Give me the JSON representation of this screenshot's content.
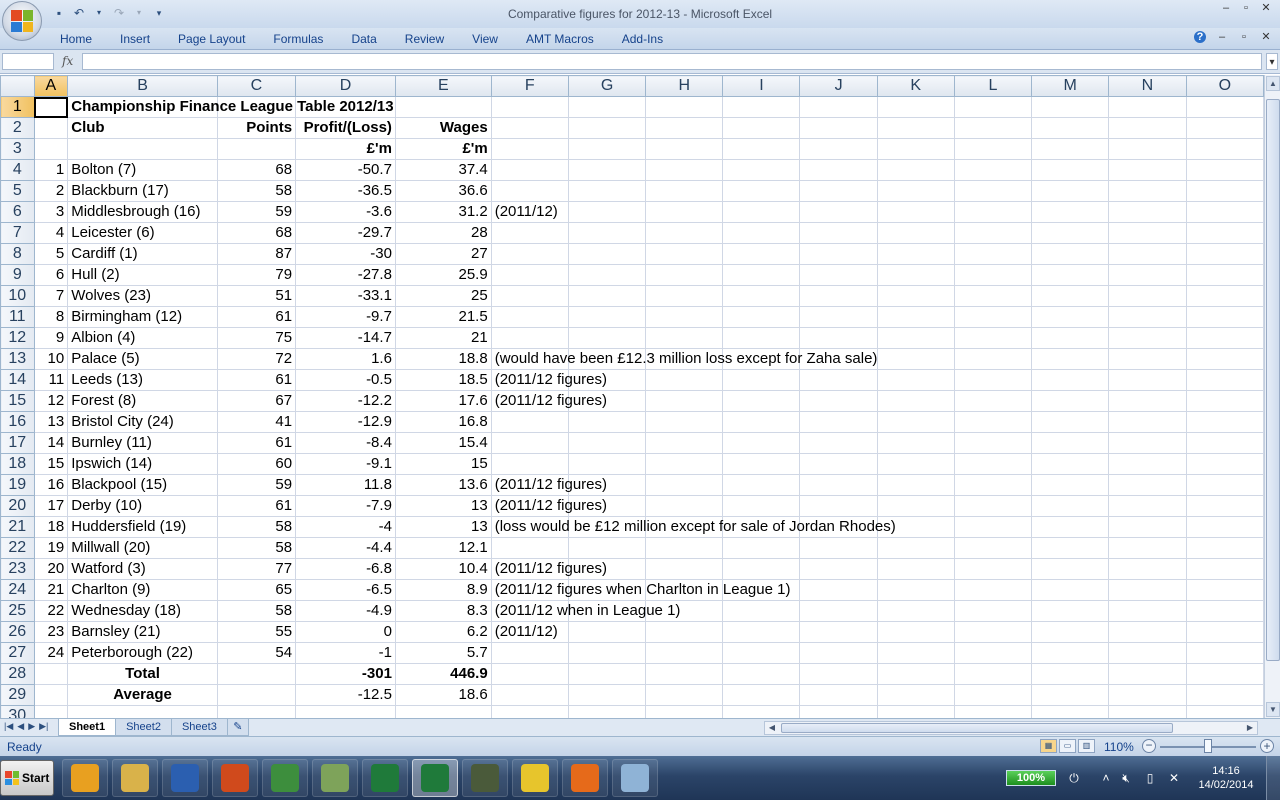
{
  "window": {
    "title": "Comparative figures for 2012-13  -  Microsoft Excel"
  },
  "ribbon": {
    "tabs": [
      "Home",
      "Insert",
      "Page Layout",
      "Formulas",
      "Data",
      "Review",
      "View",
      "AMT Macros",
      "Add-Ins"
    ]
  },
  "formula_bar": {
    "fx_label": "fx",
    "name_box": "",
    "content": ""
  },
  "sheet": {
    "columns": [
      "A",
      "B",
      "C",
      "D",
      "E",
      "F",
      "G",
      "H",
      "I",
      "J",
      "K",
      "L",
      "M",
      "N",
      "O"
    ],
    "title": "Championship Finance League Table 2012/13",
    "headers": {
      "club": "Club",
      "points": "Points",
      "profit": "Profit/(Loss)",
      "wages": "Wages",
      "unit_profit": "£'m",
      "unit_wages": "£'m"
    },
    "rows": [
      {
        "pos": "1",
        "club": "Bolton (7)",
        "points": "68",
        "profit": "-50.7",
        "wages": "37.4",
        "note": ""
      },
      {
        "pos": "2",
        "club": "Blackburn (17)",
        "points": "58",
        "profit": "-36.5",
        "wages": "36.6",
        "note": ""
      },
      {
        "pos": "3",
        "club": "Middlesbrough (16)",
        "points": "59",
        "profit": "-3.6",
        "wages": "31.2",
        "note": "(2011/12)"
      },
      {
        "pos": "4",
        "club": "Leicester (6)",
        "points": "68",
        "profit": "-29.7",
        "wages": "28",
        "note": ""
      },
      {
        "pos": "5",
        "club": "Cardiff (1)",
        "points": "87",
        "profit": "-30",
        "wages": "27",
        "note": ""
      },
      {
        "pos": "6",
        "club": "Hull (2)",
        "points": "79",
        "profit": "-27.8",
        "wages": "25.9",
        "note": ""
      },
      {
        "pos": "7",
        "club": "Wolves (23)",
        "points": "51",
        "profit": "-33.1",
        "wages": "25",
        "note": ""
      },
      {
        "pos": "8",
        "club": "Birmingham (12)",
        "points": "61",
        "profit": "-9.7",
        "wages": "21.5",
        "note": ""
      },
      {
        "pos": "9",
        "club": "Albion (4)",
        "points": "75",
        "profit": "-14.7",
        "wages": "21",
        "note": ""
      },
      {
        "pos": "10",
        "club": "Palace (5)",
        "points": "72",
        "profit": "1.6",
        "wages": "18.8",
        "note": "(would have been £12.3 million loss except for Zaha sale)"
      },
      {
        "pos": "11",
        "club": "Leeds (13)",
        "points": "61",
        "profit": "-0.5",
        "wages": "18.5",
        "note": "(2011/12 figures)"
      },
      {
        "pos": "12",
        "club": "Forest (8)",
        "points": "67",
        "profit": "-12.2",
        "wages": "17.6",
        "note": "(2011/12 figures)"
      },
      {
        "pos": "13",
        "club": "Bristol City (24)",
        "points": "41",
        "profit": "-12.9",
        "wages": "16.8",
        "note": ""
      },
      {
        "pos": "14",
        "club": "Burnley (11)",
        "points": "61",
        "profit": "-8.4",
        "wages": "15.4",
        "note": ""
      },
      {
        "pos": "15",
        "club": "Ipswich (14)",
        "points": "60",
        "profit": "-9.1",
        "wages": "15",
        "note": ""
      },
      {
        "pos": "16",
        "club": "Blackpool (15)",
        "points": "59",
        "profit": "11.8",
        "wages": "13.6",
        "note": "(2011/12 figures)"
      },
      {
        "pos": "17",
        "club": "Derby (10)",
        "points": "61",
        "profit": "-7.9",
        "wages": "13",
        "note": "(2011/12 figures)"
      },
      {
        "pos": "18",
        "club": "Huddersfield (19)",
        "points": "58",
        "profit": "-4",
        "wages": "13",
        "note": "(loss would be £12 million except for sale of Jordan Rhodes)"
      },
      {
        "pos": "19",
        "club": "Millwall (20)",
        "points": "58",
        "profit": "-4.4",
        "wages": "12.1",
        "note": ""
      },
      {
        "pos": "20",
        "club": "Watford (3)",
        "points": "77",
        "profit": "-6.8",
        "wages": "10.4",
        "note": "(2011/12 figures)"
      },
      {
        "pos": "21",
        "club": "Charlton (9)",
        "points": "65",
        "profit": "-6.5",
        "wages": "8.9",
        "note": "(2011/12 figures when Charlton in League 1)"
      },
      {
        "pos": "22",
        "club": "Wednesday (18)",
        "points": "58",
        "profit": "-4.9",
        "wages": "8.3",
        "note": "(2011/12 when in League 1)"
      },
      {
        "pos": "23",
        "club": "Barnsley (21)",
        "points": "55",
        "profit": "0",
        "wages": "6.2",
        "note": "(2011/12)"
      },
      {
        "pos": "24",
        "club": "Peterborough (22)",
        "points": "54",
        "profit": "-1",
        "wages": "5.7",
        "note": ""
      }
    ],
    "total": {
      "label": "Total",
      "profit": "-301",
      "wages": "446.9"
    },
    "average": {
      "label": "Average",
      "profit": "-12.5",
      "wages": "18.6"
    }
  },
  "sheet_tabs": [
    "Sheet1",
    "Sheet2",
    "Sheet3"
  ],
  "status": {
    "text": "Ready",
    "zoom": "110%"
  },
  "taskbar": {
    "start_label": "Start",
    "battery": "100%",
    "clock_time": "14:16",
    "clock_date": "14/02/2014",
    "apps": [
      {
        "name": "outlook-icon",
        "color": "#e8a020"
      },
      {
        "name": "file-explorer-icon",
        "color": "#d9b24a"
      },
      {
        "name": "word-icon",
        "color": "#2b5fb0"
      },
      {
        "name": "powerpoint-icon",
        "color": "#d04a1c"
      },
      {
        "name": "chrome-icon",
        "color": "#3d8e3d"
      },
      {
        "name": "document-stack-icon",
        "color": "#7ea35a"
      },
      {
        "name": "excel-icon",
        "color": "#1f7a3a"
      },
      {
        "name": "excel-window-icon",
        "color": "#1f7a3a"
      },
      {
        "name": "terminal-icon",
        "color": "#4a5a3a"
      },
      {
        "name": "bird-app-icon",
        "color": "#e7c52c"
      },
      {
        "name": "firefox-icon",
        "color": "#e66a1a"
      },
      {
        "name": "paint-icon",
        "color": "#8fb3d6"
      }
    ]
  }
}
